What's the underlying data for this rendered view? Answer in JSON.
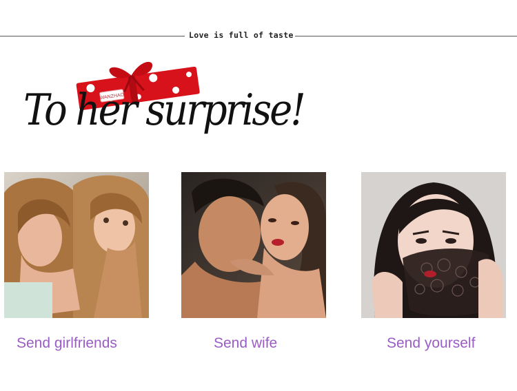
{
  "header": {
    "tagline": "Love is full of taste"
  },
  "headline": {
    "text": "To her surprise!",
    "gift_tag_text": "WANZHAO"
  },
  "cards": [
    {
      "caption": "Send girlfriends",
      "image_name": "girlfriends-photo"
    },
    {
      "caption": "Send wife",
      "image_name": "couple-photo"
    },
    {
      "caption": "Send yourself",
      "image_name": "woman-lace-photo"
    }
  ],
  "colors": {
    "caption": "#9a5cc6",
    "gift_red": "#d8121b",
    "rule_line": "#555555"
  }
}
